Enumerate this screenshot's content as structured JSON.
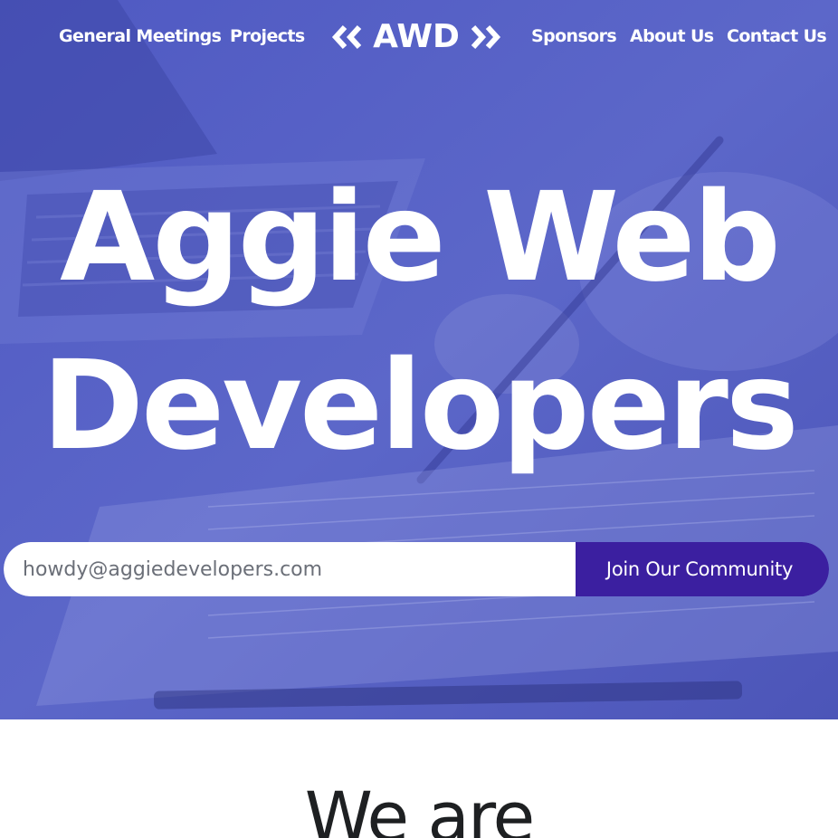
{
  "nav": {
    "items": [
      {
        "label": "General Meetings"
      },
      {
        "label": "Projects"
      },
      {
        "label": "Sponsors"
      },
      {
        "label": "About Us"
      },
      {
        "label": "Contact Us"
      }
    ],
    "brand": "AWD",
    "brand_icons": [
      "double-chevron-left-icon",
      "double-chevron-right-icon"
    ]
  },
  "hero": {
    "title_line1": "Aggie Web",
    "title_line2": "Developers",
    "background_image": "laptop-and-notebook-photo"
  },
  "signup": {
    "placeholder": "howdy@aggiedevelopers.com",
    "value": "",
    "button_label": "Join Our Community"
  },
  "intro": {
    "heading": "We are"
  },
  "colors": {
    "hero_overlay": "#5a63c4",
    "button": "#3b1fa0",
    "text_light": "#ffffff",
    "text_dark": "#1e2022"
  }
}
